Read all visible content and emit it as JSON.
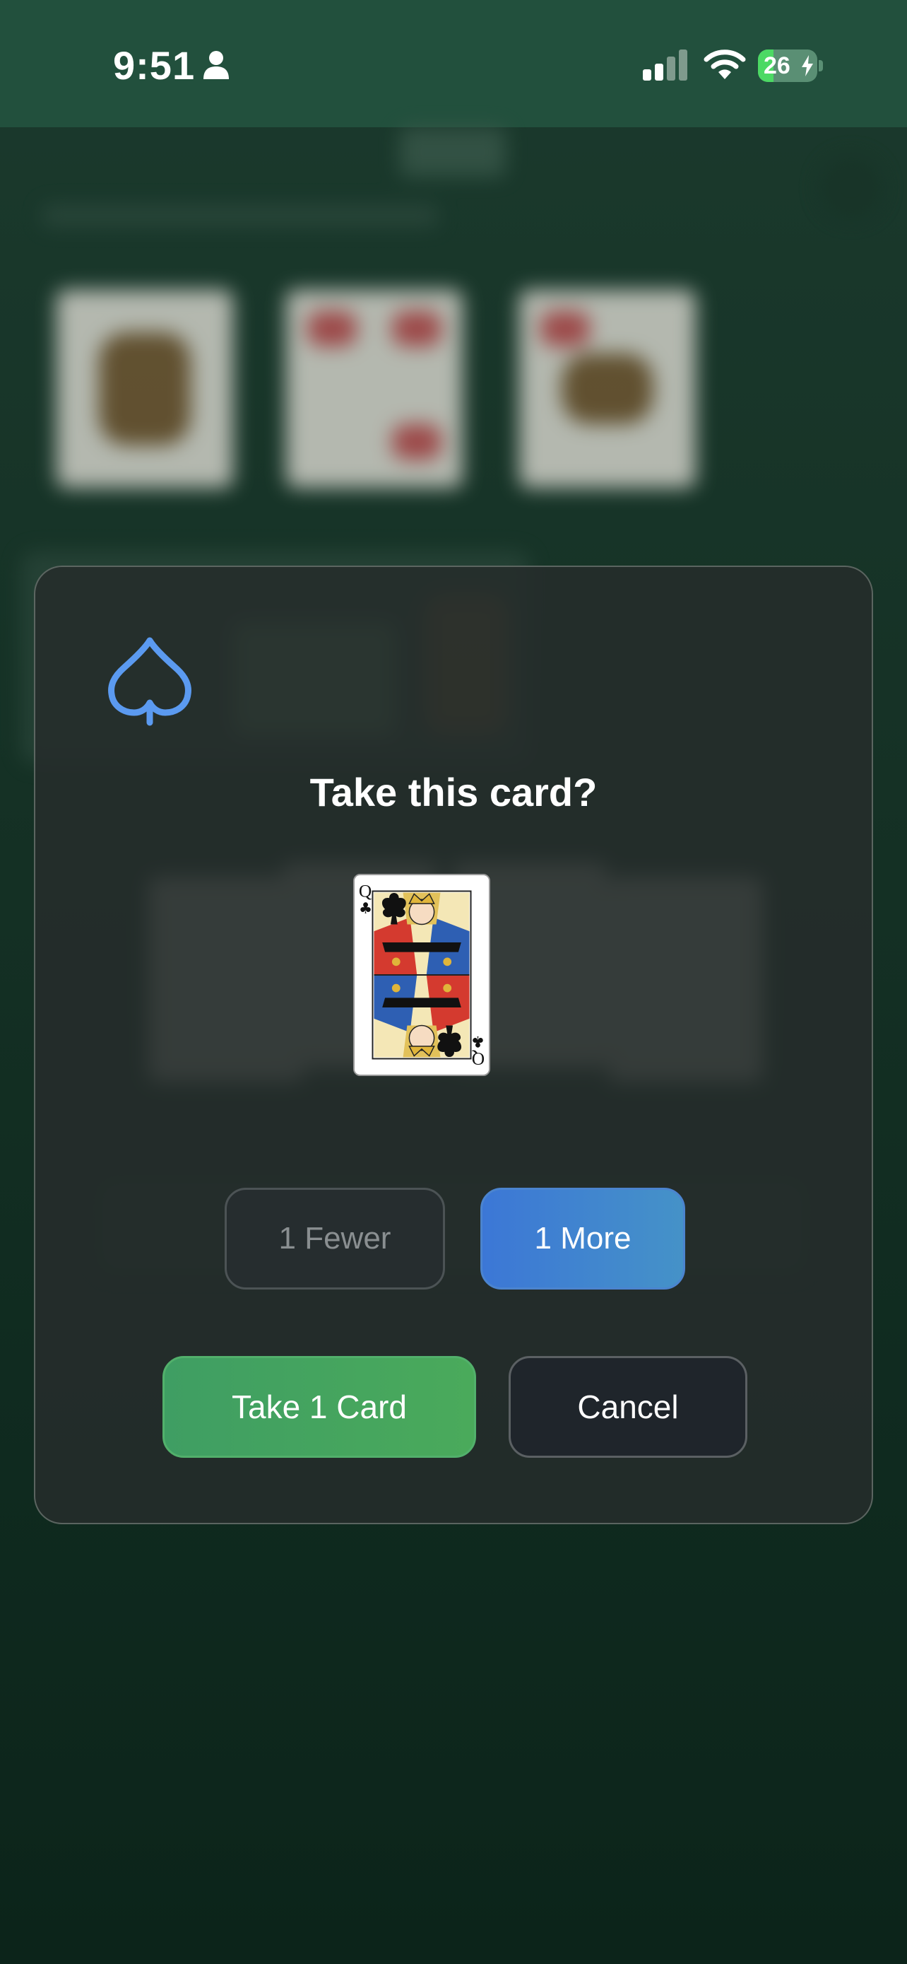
{
  "status_bar": {
    "time": "9:51",
    "battery_level": "26",
    "icons": {
      "person": "person-icon",
      "signal": "cellular-signal-icon",
      "wifi": "wifi-icon",
      "battery": "battery-charging-icon"
    }
  },
  "dialog": {
    "icon": "spade-outline-icon",
    "title": "Take this card?",
    "card": {
      "rank": "Q",
      "suit": "clubs",
      "suit_symbol": "♣"
    },
    "fewer_label": "1 Fewer",
    "more_label": "1 More",
    "take_label": "Take 1 Card",
    "cancel_label": "Cancel"
  },
  "colors": {
    "accent_blue": "#3c77d6",
    "spade_icon": "#5b9af0",
    "take_green": "#46a35f",
    "status_bar": "#22503d",
    "table_green": "#153125"
  }
}
